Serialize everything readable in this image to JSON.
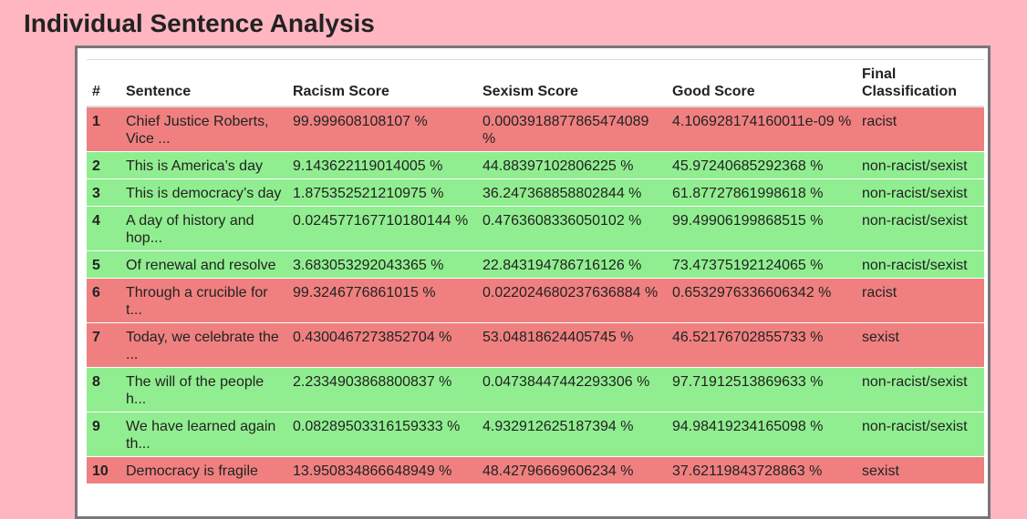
{
  "page": {
    "title": "Individual Sentence Analysis"
  },
  "table": {
    "headers": [
      "#",
      "Sentence",
      "Racism Score",
      "Sexism Score",
      "Good Score",
      "Final Classification"
    ],
    "rows": [
      {
        "n": "1",
        "sentence": "Chief Justice Roberts, Vice ...",
        "racism": "99.999608108107 %",
        "sexism": "0.0003918877865474089 %",
        "good": "4.106928174160011e-09 %",
        "cls": "racist",
        "color": "#f08080"
      },
      {
        "n": "2",
        "sentence": "This is America’s day",
        "racism": "9.143622119014005 %",
        "sexism": "44.88397102806225 %",
        "good": "45.97240685292368 %",
        "cls": "non-racist/sexist",
        "color": "#90ee90"
      },
      {
        "n": "3",
        "sentence": "This is democracy’s day",
        "racism": "1.875352521210975 %",
        "sexism": "36.247368858802844 %",
        "good": "61.87727861998618 %",
        "cls": "non-racist/sexist",
        "color": "#90ee90"
      },
      {
        "n": "4",
        "sentence": "A day of history and hop...",
        "racism": "0.024577167710180144 %",
        "sexism": "0.4763608336050102 %",
        "good": "99.49906199868515 %",
        "cls": "non-racist/sexist",
        "color": "#90ee90"
      },
      {
        "n": "5",
        "sentence": "Of renewal and resolve",
        "racism": "3.683053292043365 %",
        "sexism": "22.843194786716126 %",
        "good": "73.47375192124065 %",
        "cls": "non-racist/sexist",
        "color": "#90ee90"
      },
      {
        "n": "6",
        "sentence": "Through a crucible for t...",
        "racism": "99.3246776861015 %",
        "sexism": "0.022024680237636884 %",
        "good": "0.6532976336606342 %",
        "cls": "racist",
        "color": "#f08080"
      },
      {
        "n": "7",
        "sentence": "Today, we celebrate the ...",
        "racism": "0.4300467273852704 %",
        "sexism": "53.04818624405745 %",
        "good": "46.52176702855733 %",
        "cls": "sexist",
        "color": "#f08080"
      },
      {
        "n": "8",
        "sentence": "The will of the people h...",
        "racism": "2.2334903868800837 %",
        "sexism": "0.04738447442293306 %",
        "good": "97.71912513869633 %",
        "cls": "non-racist/sexist",
        "color": "#90ee90"
      },
      {
        "n": "9",
        "sentence": "We have learned again th...",
        "racism": "0.08289503316159333 %",
        "sexism": "4.932912625187394 %",
        "good": "94.98419234165098 %",
        "cls": "non-racist/sexist",
        "color": "#90ee90"
      },
      {
        "n": "10",
        "sentence": "Democracy is fragile",
        "racism": "13.950834866648949 %",
        "sexism": "48.42796669606234 %",
        "good": "37.62119843728863 %",
        "cls": "sexist",
        "color": "#f08080"
      }
    ]
  }
}
